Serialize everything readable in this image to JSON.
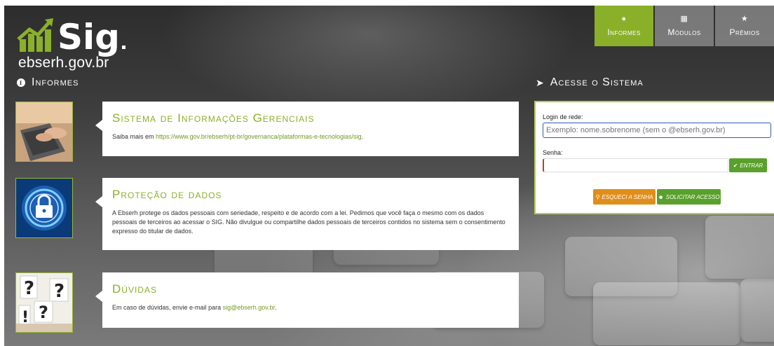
{
  "brand": {
    "logo_text": "Sig",
    "domain": "ebserh.gov.br",
    "colors": {
      "accent": "#8ab02a",
      "logo_green": "#8ab02a",
      "logo_blue": "#2a8fc4",
      "orange": "#e08e1b",
      "button_green": "#5aa02c"
    }
  },
  "nav": {
    "items": [
      {
        "label": "Informes",
        "icon": "info-icon"
      },
      {
        "label": "Módulos",
        "icon": "grid-icon"
      },
      {
        "label": "Prêmios",
        "icon": "trophy-icon"
      }
    ]
  },
  "informes": {
    "title": "Informes",
    "cards": [
      {
        "title": "Sistema de Informações Gerenciais",
        "text_before": "Saiba mais em ",
        "link": "https://www.gov.br/ebserh/pt-br/governanca/plataformas-e-tecnologias/sig",
        "text_after": ".",
        "image": "laptop-typing-image"
      },
      {
        "title": "Proteção de dados",
        "text": "A Ebserh protege os dados pessoais com seriedade, respeito e de acordo com a lei. Pedimos que você faça o mesmo com os dados pessoais de terceiros ao acessar o SIG. Não divulgue ou compartilhe dados pessoais de terceiros contidos no sistema sem o consentimento expresso do titular de dados.",
        "image": "padlock-security-image"
      },
      {
        "title": "Dúvidas",
        "text_before": "Em caso de dúvidas, envie e-mail para ",
        "link": "sig@ebserh.gov.br",
        "text_after": ".",
        "image": "question-marks-image"
      }
    ]
  },
  "login": {
    "title": "Acesse o Sistema",
    "username_label": "Login de rede:",
    "username_placeholder": "Exemplo: nome.sobrenome (sem o @ebserh.gov.br)",
    "password_label": "Senha:",
    "enter_label": "ENTRAR",
    "forgot_label": "ESQUECI A SENHA",
    "request_label": "SOLICITAR ACESSO"
  }
}
